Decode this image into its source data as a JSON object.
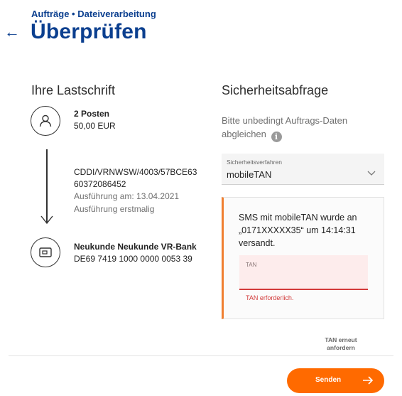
{
  "header": {
    "breadcrumb": "Aufträge • Dateiverarbeitung",
    "title": "Überprüfen",
    "back_icon": "arrow-left-icon"
  },
  "left": {
    "heading": "Ihre Lastschrift",
    "sender": {
      "icon": "person-icon",
      "count": "2 Posten",
      "amount": "50,00 EUR"
    },
    "details": {
      "reference_line1": "CDDI/VRNWSW/4003/57BCE63",
      "reference_line2": "60372086452",
      "execution_date": "Ausführung am: 13.04.2021",
      "execution_type": "Ausführung erstmalig"
    },
    "recipient": {
      "icon": "card-icon",
      "name": "Neukunde Neukunde VR-Bank",
      "iban": "DE69 7419 1000 0000 0053 39"
    }
  },
  "right": {
    "heading": "Sicherheitsabfrage",
    "hint": "Bitte unbedingt Auftrags-Daten abgleichen",
    "method": {
      "label": "Sicherheitsverfahren",
      "value": "mobileTAN"
    },
    "tan_panel": {
      "sms_text": "SMS mit mobileTAN wurde an „0171XXXXX35“ um 14:14:31 versandt.",
      "input_label": "TAN",
      "input_value": "",
      "error": "TAN erforderlich."
    },
    "resend": "TAN erneut anfordern"
  },
  "footer": {
    "send_label": "Senden"
  },
  "colors": {
    "brand_blue": "#0b3f8f",
    "accent_orange": "#ff6a00",
    "error_red": "#d23a3a"
  }
}
